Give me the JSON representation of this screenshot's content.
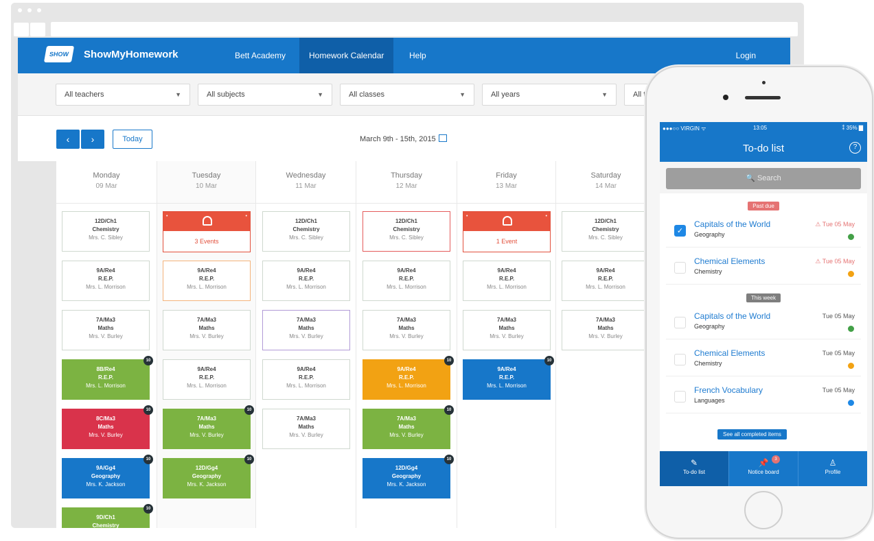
{
  "app": {
    "brand": "ShowMyHomework",
    "logo_text": "SHOW"
  },
  "nav": {
    "items": [
      "Bett Academy",
      "Homework Calendar",
      "Help"
    ],
    "login": "Login"
  },
  "filters": [
    "All teachers",
    "All subjects",
    "All classes",
    "All years",
    "All ta"
  ],
  "calendar": {
    "prev": "‹",
    "next": "›",
    "today": "Today",
    "range": "March 9th - 15th, 2015"
  },
  "days": [
    {
      "name": "Monday",
      "date": "09 Mar"
    },
    {
      "name": "Tuesday",
      "date": "10 Mar"
    },
    {
      "name": "Wednesday",
      "date": "11 Mar"
    },
    {
      "name": "Thursday",
      "date": "12 Mar"
    },
    {
      "name": "Friday",
      "date": "13 Mar"
    },
    {
      "name": "Saturday",
      "date": "14 Mar"
    }
  ],
  "cards": {
    "mon": [
      {
        "c1": "12D/Ch1",
        "c2": "Chemistry",
        "c3": "Mrs. C. Sibley"
      },
      {
        "c1": "9A/Re4",
        "c2": "R.E.P.",
        "c3": "Mrs. L. Morrison"
      },
      {
        "c1": "7A/Ma3",
        "c2": "Maths",
        "c3": "Mrs. V. Burley"
      },
      {
        "c1": "8B/Re4",
        "c2": "R.E.P.",
        "c3": "Mrs. L. Morrison",
        "badge": "10"
      },
      {
        "c1": "8C/Ma3",
        "c2": "Maths",
        "c3": "Mrs. V. Burley",
        "badge": "10"
      },
      {
        "c1": "9A/Gg4",
        "c2": "Geography",
        "c3": "Mrs. K. Jackson",
        "badge": "10"
      },
      {
        "c1": "9D/Ch1",
        "c2": "Chemistry",
        "c3": "",
        "badge": "10"
      }
    ],
    "tue": [
      {
        "event": "3 Events"
      },
      {
        "c1": "9A/Re4",
        "c2": "R.E.P.",
        "c3": "Mrs. L. Morrison"
      },
      {
        "c1": "7A/Ma3",
        "c2": "Maths",
        "c3": "Mrs. V. Burley"
      },
      {
        "c1": "9A/Re4",
        "c2": "R.E.P.",
        "c3": "Mrs. L. Morrison"
      },
      {
        "c1": "7A/Ma3",
        "c2": "Maths",
        "c3": "Mrs. V. Burley",
        "badge": "10"
      },
      {
        "c1": "12D/Gg4",
        "c2": "Geography",
        "c3": "Mrs. K. Jackson",
        "badge": "10"
      }
    ],
    "wed": [
      {
        "c1": "12D/Ch1",
        "c2": "Chemistry",
        "c3": "Mrs. C. Sibley"
      },
      {
        "c1": "9A/Re4",
        "c2": "R.E.P.",
        "c3": "Mrs. L. Morrison"
      },
      {
        "c1": "7A/Ma3",
        "c2": "Maths",
        "c3": "Mrs. V. Burley"
      },
      {
        "c1": "9A/Re4",
        "c2": "R.E.P.",
        "c3": "Mrs. L. Morrison"
      },
      {
        "c1": "7A/Ma3",
        "c2": "Maths",
        "c3": "Mrs. V. Burley"
      }
    ],
    "thu": [
      {
        "c1": "12D/Ch1",
        "c2": "Chemistry",
        "c3": "Mrs. C. Sibley"
      },
      {
        "c1": "9A/Re4",
        "c2": "R.E.P.",
        "c3": "Mrs. L. Morrison"
      },
      {
        "c1": "7A/Ma3",
        "c2": "Maths",
        "c3": "Mrs. V. Burley"
      },
      {
        "c1": "9A/Re4",
        "c2": "R.E.P.",
        "c3": "Mrs. L. Morrison",
        "badge": "10"
      },
      {
        "c1": "7A/Ma3",
        "c2": "Maths",
        "c3": "Mrs. V. Burley",
        "badge": "10"
      },
      {
        "c1": "12D/Gg4",
        "c2": "Geography",
        "c3": "Mrs. K. Jackson",
        "badge": "10"
      }
    ],
    "fri": [
      {
        "event": "1 Event"
      },
      {
        "c1": "9A/Re4",
        "c2": "R.E.P.",
        "c3": "Mrs. L. Morrison"
      },
      {
        "c1": "7A/Ma3",
        "c2": "Maths",
        "c3": "Mrs. V. Burley"
      },
      {
        "c1": "9A/Re4",
        "c2": "R.E.P.",
        "c3": "Mrs. L. Morrison",
        "badge": "10"
      }
    ],
    "sat": [
      {
        "c1": "12D/Ch1",
        "c2": "Chemistry",
        "c3": "Mrs. C. Sibley"
      },
      {
        "c1": "9A/Re4",
        "c2": "R.E.P.",
        "c3": "Mrs. L. Morrison"
      },
      {
        "c1": "7A/Ma3",
        "c2": "Maths",
        "c3": "Mrs. V. Burley"
      }
    ]
  },
  "phone": {
    "status": {
      "carrier": "●●●○○ VIRGIN ᯤ",
      "time": "13:05",
      "battery": "⁑ 35% ▇"
    },
    "title": "To-do list",
    "help": "?",
    "search": "🔍 Search",
    "past_due": "Past due",
    "this_week": "This week",
    "tasks": [
      {
        "name": "Capitals of the World",
        "subject": "Geography",
        "date": "⚠ Tue 05 May",
        "color": "#43a047"
      },
      {
        "name": "Chemical Elements",
        "subject": "Chemistry",
        "date": "⚠ Tue 05 May",
        "color": "#f2a213"
      },
      {
        "name": "Capitals of the World",
        "subject": "Geography",
        "date": "Tue 05 May",
        "color": "#43a047"
      },
      {
        "name": "Chemical Elements",
        "subject": "Chemistry",
        "date": "Tue 05 May",
        "color": "#f2a213"
      },
      {
        "name": "French Vocabulary",
        "subject": "Languages",
        "date": "Tue 05 May",
        "color": "#1e88e5"
      }
    ],
    "see_all": "See all completed items",
    "tabs": [
      {
        "label": "To-do list",
        "icon": "✎"
      },
      {
        "label": "Notice board",
        "icon": "📌",
        "badge": "3"
      },
      {
        "label": "Profile",
        "icon": "♙"
      }
    ]
  },
  "colors": {
    "brand_blue": "#1777c9",
    "event_red": "#e8533d",
    "green": "#7cb342",
    "red": "#d9334b",
    "orange": "#f2a213"
  }
}
